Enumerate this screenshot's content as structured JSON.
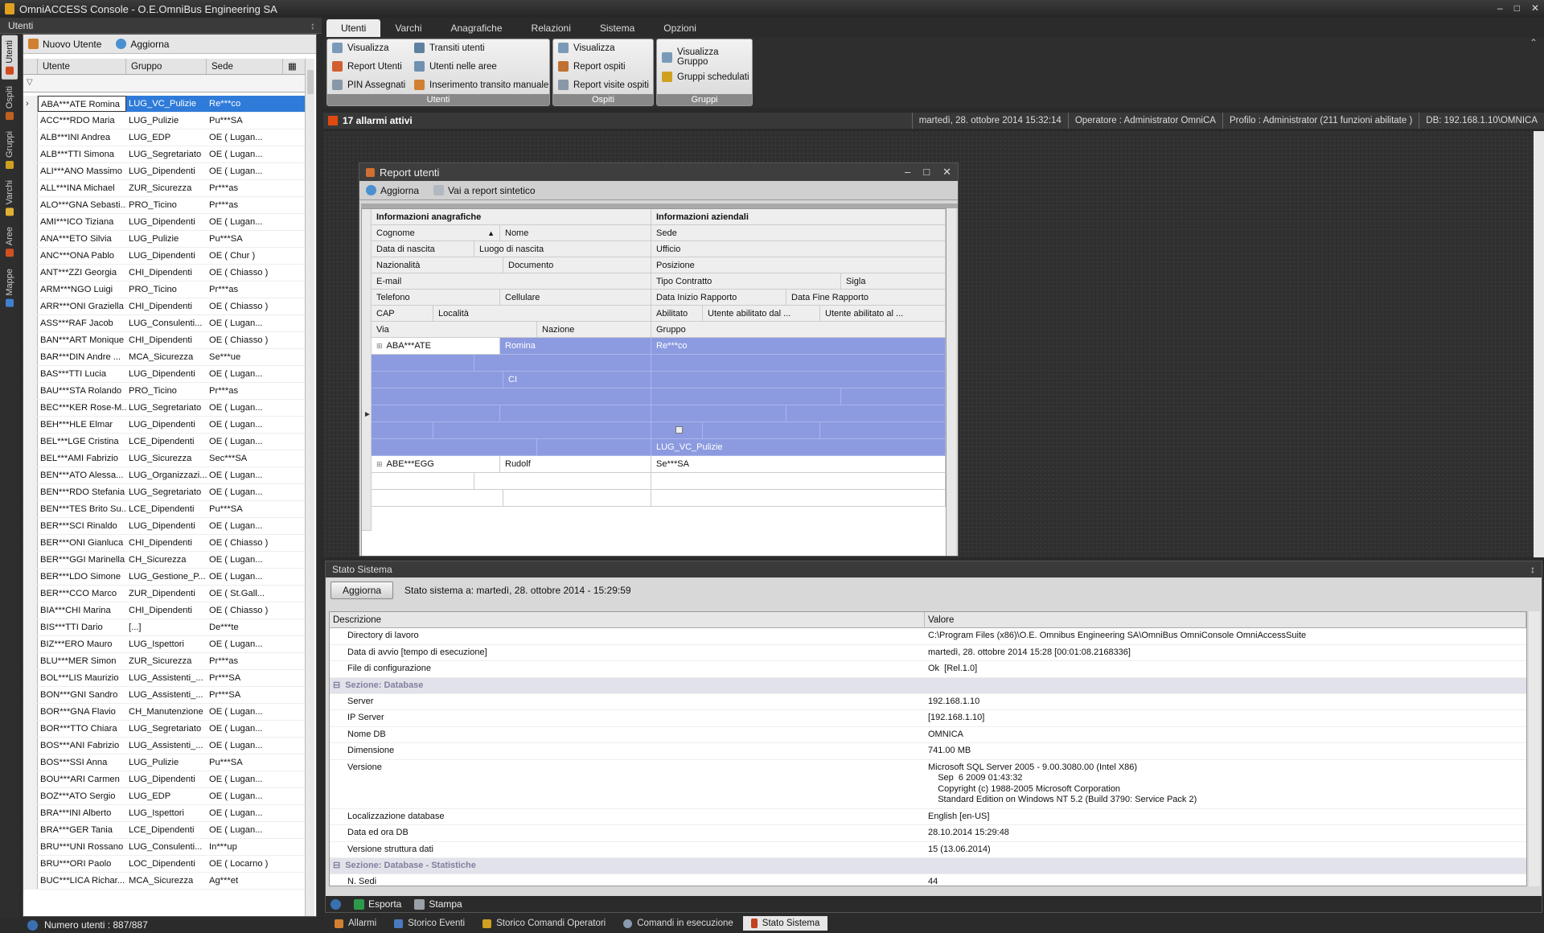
{
  "window": {
    "title": "OmniACCESS Console - O.E.OmniBus Engineering SA"
  },
  "left_panel": {
    "title": "Utenti",
    "vertical_tabs": [
      "Utenti",
      "Ospiti",
      "Gruppi",
      "Varchi",
      "Aree",
      "Mappe"
    ],
    "toolbar": {
      "new_user": "Nuovo Utente",
      "refresh": "Aggiorna"
    },
    "columns": [
      "Utente",
      "Gruppo",
      "Sede"
    ],
    "rows": [
      [
        "ABA***ATE Romina",
        "LUG_VC_Pulizie",
        "Re***co"
      ],
      [
        "ACC***RDO Maria",
        "LUG_Pulizie",
        "Pu***SA"
      ],
      [
        "ALB***INI Andrea",
        "LUG_EDP",
        "OE ( Lugan..."
      ],
      [
        "ALB***TTI Simona",
        "LUG_Segretariato",
        "OE ( Lugan..."
      ],
      [
        "ALI***ANO Massimo",
        "LUG_Dipendenti",
        "OE ( Lugan..."
      ],
      [
        "ALL***INA Michael",
        "ZUR_Sicurezza",
        "Pr***as"
      ],
      [
        "ALO***GNA Sebasti...",
        "PRO_Ticino",
        "Pr***as"
      ],
      [
        "AMI***ICO Tiziana",
        "LUG_Dipendenti",
        "OE ( Lugan..."
      ],
      [
        "ANA***ETO Silvia",
        "LUG_Pulizie",
        "Pu***SA"
      ],
      [
        "ANC***ONA Pablo",
        "LUG_Dipendenti",
        "OE ( Chur )"
      ],
      [
        "ANT***ZZI Georgia",
        "CHI_Dipendenti",
        "OE ( Chiasso )"
      ],
      [
        "ARM***NGO Luigi",
        "PRO_Ticino",
        "Pr***as"
      ],
      [
        "ARR***ONI Graziella",
        "CHI_Dipendenti",
        "OE ( Chiasso )"
      ],
      [
        "ASS***RAF Jacob",
        "LUG_Consulenti...",
        "OE ( Lugan..."
      ],
      [
        "BAN***ART Monique",
        "CHI_Dipendenti",
        "OE ( Chiasso )"
      ],
      [
        "BAR***DIN Andre ...",
        "MCA_Sicurezza",
        "Se***ue"
      ],
      [
        "BAS***TTI Lucia",
        "LUG_Dipendenti",
        "OE ( Lugan..."
      ],
      [
        "BAU***STA Rolando",
        "PRO_Ticino",
        "Pr***as"
      ],
      [
        "BEC***KER Rose-M...",
        "LUG_Segretariato",
        "OE ( Lugan..."
      ],
      [
        "BEH***HLE Elmar",
        "LUG_Dipendenti",
        "OE ( Lugan..."
      ],
      [
        "BEL***LGE Cristina",
        "LCE_Dipendenti",
        "OE ( Lugan..."
      ],
      [
        "BEL***AMI Fabrizio",
        "LUG_Sicurezza",
        "Sec***SA"
      ],
      [
        "BEN***ATO Alessa...",
        "LUG_Organizzazi...",
        "OE ( Lugan..."
      ],
      [
        "BEN***RDO Stefania",
        "LUG_Segretariato",
        "OE ( Lugan..."
      ],
      [
        "BEN***TES Brito Su...",
        "LCE_Dipendenti",
        "Pu***SA"
      ],
      [
        "BER***SCI Rinaldo",
        "LUG_Dipendenti",
        "OE ( Lugan..."
      ],
      [
        "BER***ONI Gianluca",
        "CHI_Dipendenti",
        "OE ( Chiasso )"
      ],
      [
        "BER***GGI Marinella",
        "CH_Sicurezza",
        "OE ( Lugan..."
      ],
      [
        "BER***LDO Simone",
        "LUG_Gestione_P...",
        "OE ( Lugan..."
      ],
      [
        "BER***CCO Marco",
        "ZUR_Dipendenti",
        "OE ( St.Gall..."
      ],
      [
        "BIA***CHI Marina",
        "CHI_Dipendenti",
        "OE ( Chiasso )"
      ],
      [
        "BIS***TTI Dario",
        "[...]",
        "De***te"
      ],
      [
        "BIZ***ERO Mauro",
        "LUG_Ispettori",
        "OE ( Lugan..."
      ],
      [
        "BLU***MER Simon",
        "ZUR_Sicurezza",
        "Pr***as"
      ],
      [
        "BOL***LIS Maurizio",
        "LUG_Assistenti_...",
        "Pr***SA"
      ],
      [
        "BON***GNI Sandro",
        "LUG_Assistenti_...",
        "Pr***SA"
      ],
      [
        "BOR***GNA Flavio",
        "CH_Manutenzione",
        "OE ( Lugan..."
      ],
      [
        "BOR***TTO Chiara",
        "LUG_Segretariato",
        "OE ( Lugan..."
      ],
      [
        "BOS***ANI Fabrizio",
        "LUG_Assistenti_...",
        "OE ( Lugan..."
      ],
      [
        "BOS***SSI Anna",
        "LUG_Pulizie",
        "Pu***SA"
      ],
      [
        "BOU***ARI Carmen",
        "LUG_Dipendenti",
        "OE ( Lugan..."
      ],
      [
        "BOZ***ATO Sergio",
        "LUG_EDP",
        "OE ( Lugan..."
      ],
      [
        "BRA***INI Alberto",
        "LUG_Ispettori",
        "OE ( Lugan..."
      ],
      [
        "BRA***GER Tania",
        "LCE_Dipendenti",
        "OE ( Lugan..."
      ],
      [
        "BRU***UNI Rossano",
        "LUG_Consulenti...",
        "In***up"
      ],
      [
        "BRU***ORI Paolo",
        "LOC_Dipendenti",
        "OE ( Locarno )"
      ],
      [
        "BUC***LICA Richar...",
        "MCA_Sicurezza",
        "Ag***et"
      ]
    ],
    "status": "Numero utenti : 887/887"
  },
  "ribbon": {
    "tabs": [
      "Utenti",
      "Varchi",
      "Anagrafiche",
      "Relazioni",
      "Sistema",
      "Opzioni"
    ],
    "groups": [
      {
        "label": "Utenti",
        "items": [
          "Visualizza",
          "Report Utenti",
          "PIN Assegnati",
          "Transiti utenti",
          "Utenti nelle aree",
          "Inserimento transito manuale"
        ]
      },
      {
        "label": "Ospiti",
        "items": [
          "Visualizza",
          "Report ospiti",
          "Report visite ospiti"
        ]
      },
      {
        "label": "Gruppi",
        "items": [
          "Visualizza Gruppo",
          "Gruppi schedulati"
        ]
      }
    ]
  },
  "status_bar": {
    "alarms": "17  allarmi attivi",
    "datetime": "martedì, 28. ottobre 2014  15:32:14",
    "operator": "Operatore : Administrator OmniCA",
    "profile": "Profilo : Administrator (211 funzioni abilitate )",
    "db": "DB: 192.168.1.10\\OMNICA"
  },
  "report_dialog": {
    "title": "Report utenti",
    "toolbar": {
      "refresh": "Aggiorna",
      "summary": "Vai a report sintetico"
    },
    "section_left": "Informazioni anagrafiche",
    "section_right": "Informazioni aziendali",
    "fields": {
      "cognome": "Cognome",
      "nome": "Nome",
      "sede": "Sede",
      "data_nascita": "Data di nascita",
      "luogo_nascita": "Luogo di nascita",
      "ufficio": "Ufficio",
      "nazionalita": "Nazionalità",
      "documento": "Documento",
      "posizione": "Posizione",
      "email": "E-mail",
      "tipo_contratto": "Tipo Contratto",
      "sigla": "Sigla",
      "telefono": "Telefono",
      "cellulare": "Cellulare",
      "data_inizio": "Data Inizio Rapporto",
      "data_fine": "Data Fine Rapporto",
      "cap": "CAP",
      "localita": "Località",
      "abilitato": "Abilitato",
      "abil_dal": "Utente abilitato dal ...",
      "abil_al": "Utente abilitato al ...",
      "via": "Via",
      "nazione": "Nazione",
      "gruppo": "Gruppo"
    },
    "records": [
      {
        "cognome": "ABA***ATE",
        "nome": "Romina",
        "sede": "Re***co",
        "nazionalita": "CI",
        "gruppo": "LUG_VC_Pulizie"
      },
      {
        "cognome": "ABE***EGG",
        "nome": "Rudolf",
        "sede": "Se***SA"
      }
    ]
  },
  "system_panel": {
    "title": "Stato Sistema",
    "refresh": "Aggiorna",
    "state_label": "Stato sistema a:  martedì, 28. ottobre 2014 - 15:29:59",
    "columns": [
      "Descrizione",
      "Valore"
    ],
    "rows": [
      {
        "k": "Directory di lavoro",
        "v": "C:\\Program Files (x86)\\O.E. Omnibus Engineering SA\\OmniBus OmniConsole OmniAccessSuite"
      },
      {
        "k": "Data di avvio [tempo di esecuzione]",
        "v": "martedì, 28. ottobre 2014 15:28 [00:01:08.2168336]"
      },
      {
        "k": "File di configurazione",
        "v": "Ok  [Rel.1.0]"
      },
      {
        "section": "Sezione: Database"
      },
      {
        "k": "Server",
        "v": "192.168.1.10"
      },
      {
        "k": "IP Server",
        "v": "[192.168.1.10]"
      },
      {
        "k": "Nome DB",
        "v": "OMNICA"
      },
      {
        "k": "Dimensione",
        "v": "741.00 MB"
      },
      {
        "k": "Versione",
        "v": "Microsoft SQL Server 2005 - 9.00.3080.00 (Intel X86)\n    Sep  6 2009 01:43:32\n    Copyright (c) 1988-2005 Microsoft Corporation\n    Standard Edition on Windows NT 5.2 (Build 3790: Service Pack 2)"
      },
      {
        "k": "Localizzazione database",
        "v": "English [en-US]"
      },
      {
        "k": "Data ed ora DB",
        "v": "28.10.2014 15:29:48"
      },
      {
        "k": "Versione struttura dati",
        "v": "15 (13.06.2014)"
      },
      {
        "section": "Sezione: Database - Statistiche"
      },
      {
        "k": "N. Sedi",
        "v": "44"
      }
    ],
    "footer": {
      "export": "Esporta",
      "print": "Stampa"
    }
  },
  "bottom_tabs": [
    "Allarmi",
    "Storico Eventi",
    "Storico Comandi Operatori",
    "Comandi in esecuzione",
    "Stato Sistema"
  ]
}
